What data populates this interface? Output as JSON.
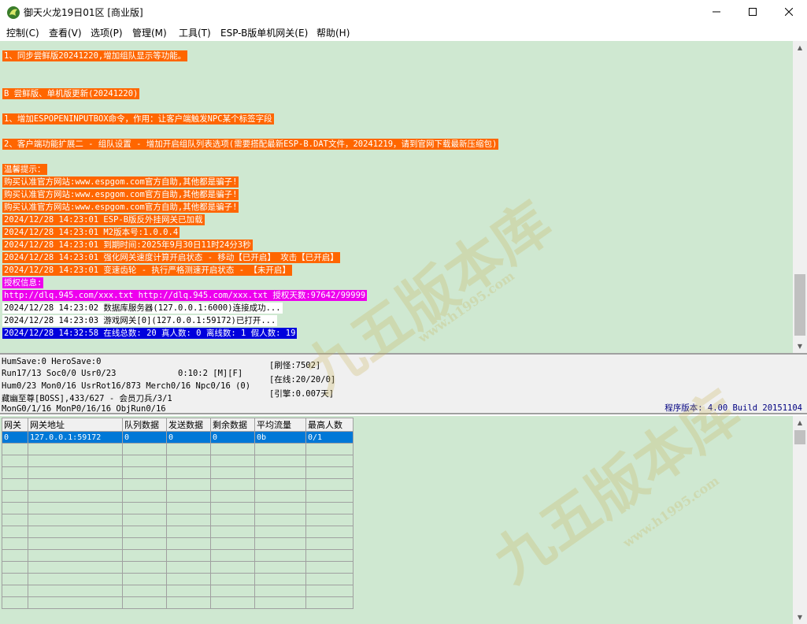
{
  "window": {
    "title": "御天火龙19日01区 [商业版]",
    "controls": {
      "minimize": "—",
      "maximize": "☐",
      "close": "✕"
    }
  },
  "menu": [
    "控制(C)",
    "查看(V)",
    "选项(P)",
    "管理(M)",
    "工具(T)",
    "ESP-B版单机网关(E)",
    "帮助(H)"
  ],
  "log": [
    {
      "text": "1、同步尝鲜版20241220,增加组队显示等功能。",
      "style": "orange"
    },
    {
      "text": "B 尝鲜版、单机版更新(20241220)",
      "style": "orange"
    },
    {
      "text": "1、增加ESPOPENINPUTBOX命令，作用：让客户端触发NPC某个标签字段",
      "style": "orange"
    },
    {
      "text": "2、客户端功能扩展二 - 组队设置 - 增加开启组队列表选项(需要搭配最新ESP-B.DAT文件，20241219，请到官网下载最新压缩包)",
      "style": "orange"
    },
    {
      "text": "温馨提示：",
      "style": "orange"
    },
    {
      "text": "购买认准官方网站:www.espgom.com官方自助,其他都是骗子!",
      "style": "orange"
    },
    {
      "text": "购买认准官方网站:www.espgom.com官方自助,其他都是骗子!",
      "style": "orange"
    },
    {
      "text": "购买认准官方网站:www.espgom.com官方自助,其他都是骗子!",
      "style": "orange"
    },
    {
      "text": "2024/12/28 14:23:01 ESP-B版反外挂网关已加载",
      "style": "orange"
    },
    {
      "text": "2024/12/28 14:23:01 M2版本号:1.0.0.4",
      "style": "orange"
    },
    {
      "text": "2024/12/28 14:23:01 到期时间:2025年9月30日11时24分3秒",
      "style": "orange"
    },
    {
      "text": "2024/12/28 14:23:01 强化网关速度计算开启状态 - 移动【已开启】 攻击【已开启】",
      "style": "orange"
    },
    {
      "text": "2024/12/28 14:23:01 变速齿轮 - 执行严格测速开启状态 - 【未开启】",
      "style": "orange"
    },
    {
      "text": "授权信息:",
      "style": "magenta"
    },
    {
      "text": "http://dlq.945.com/xxx.txt http://dlq.945.com/xxx.txt 授权天数:97642/99999",
      "style": "magenta"
    },
    {
      "text": "2024/12/28 14:23:02 数据库服务器(127.0.0.1:6000)连接成功...",
      "style": "white"
    },
    {
      "text": "2024/12/28 14:23:03 游戏网关[0](127.0.0.1:59172)已打开...",
      "style": "white"
    },
    {
      "text": "2024/12/28 14:32:58 在线总数: 20 真人数: 0 离线数: 1 假人数: 19",
      "style": "blue"
    }
  ],
  "status": {
    "line1": "HumSave:0 HeroSave:0",
    "line2": "Run17/13 Soc0/0 Usr0/23",
    "timer": "0:10:2 [M][F]",
    "line3": "Hum0/23 Mon0/16 UsrRot16/873 Merch0/16 Npc0/16 (0)",
    "line4": "藏幽至尊[BOSS],433/627 - 会员刀兵/3/1",
    "line5": "MonG0/1/16 MonP0/16/16 ObjRun0/16",
    "refresh": "[刷怪:7502]",
    "online": "[在线:20/20/0]",
    "engine": "[引擎:0.007天]",
    "version": "程序版本: 4.00 Build 20151104"
  },
  "gateway_table": {
    "headers": [
      "网关",
      "网关地址",
      "队列数据",
      "发送数据",
      "剩余数据",
      "平均流量",
      "最高人数"
    ],
    "rows": [
      [
        "0",
        "127.0.0.1:59172",
        "0",
        "0",
        "0",
        "0b",
        "0/1"
      ]
    ]
  },
  "watermark": {
    "text": "九五版本库",
    "url": "www.h1995.com"
  },
  "colors": {
    "log_bg": "#cfe8d1",
    "orange": "#ff6600",
    "magenta": "#ee00ee",
    "blue": "#0000dd",
    "selection": "#0078d7"
  }
}
